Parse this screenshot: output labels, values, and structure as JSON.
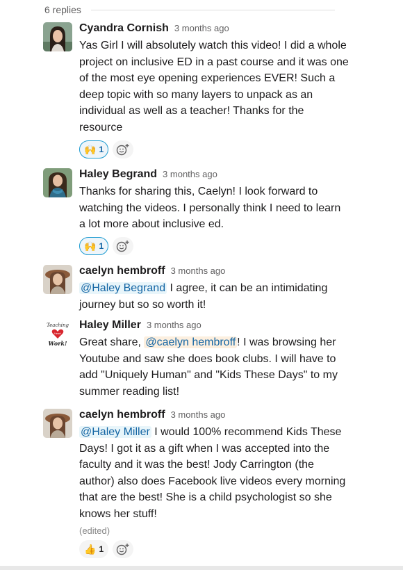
{
  "thread": {
    "replies_label": "6 replies"
  },
  "messages": [
    {
      "author": "Cyandra Cornish",
      "time": "3 months ago",
      "avatar_icon": "avatar-cyandra-icon",
      "text": "Yas Girl I will absolutely watch this video! I did a whole project on inclusive ED in a past course and it was one of the most eye opening experiences EVER! Such a deep topic with so many layers to unpack as an individual as well as a teacher! Thanks for the resource",
      "reaction": {
        "emoji": "🙌",
        "count": "1"
      }
    },
    {
      "author": "Haley Begrand",
      "time": "3 months ago",
      "avatar_icon": "avatar-haley-begrand-icon",
      "text": "Thanks for sharing this, Caelyn! I look forward to watching the videos. I personally think I need to learn a lot more about inclusive ed.",
      "reaction": {
        "emoji": "🙌",
        "count": "1"
      }
    },
    {
      "author": "caelyn hembroff",
      "time": "3 months ago",
      "avatar_icon": "avatar-caelyn-icon",
      "mention": "@Haley Begrand",
      "text": " I agree, it can be an intimidating journey but so so worth it!"
    },
    {
      "author": "Haley Miller",
      "time": "3 months ago",
      "avatar_icon": "teaching-heart-work-logo",
      "avatar_logo_text": [
        "Teaching",
        "Heart",
        "Work!"
      ],
      "text_before": "Great share, ",
      "mention": "@caelyn hembroff",
      "text_after": "! I was browsing her Youtube and saw she does book clubs. I will have to add  \"Uniquely Human\" and \"Kids These Days\" to my summer reading list!"
    },
    {
      "author": "caelyn hembroff",
      "time": "3 months ago",
      "avatar_icon": "avatar-caelyn-icon",
      "mention": "@Haley Miller",
      "text": "  I would 100% recommend Kids These Days! I got it as a gift when I was accepted into the faculty and it was the best! Jody Carrington (the author) also does Facebook live videos every morning that are the best! She is a child psychologist so she knows her stuff!",
      "edited": "(edited)",
      "reaction": {
        "emoji": "👍",
        "count": "1"
      }
    }
  ],
  "icons": {
    "add_reaction": "add-reaction-icon"
  },
  "colors": {
    "mention_bg": "#e8f5fa",
    "mention_self_bg": "#fcefdf",
    "mention_text": "#1264a3",
    "reaction_border": "#1d9bd1"
  }
}
